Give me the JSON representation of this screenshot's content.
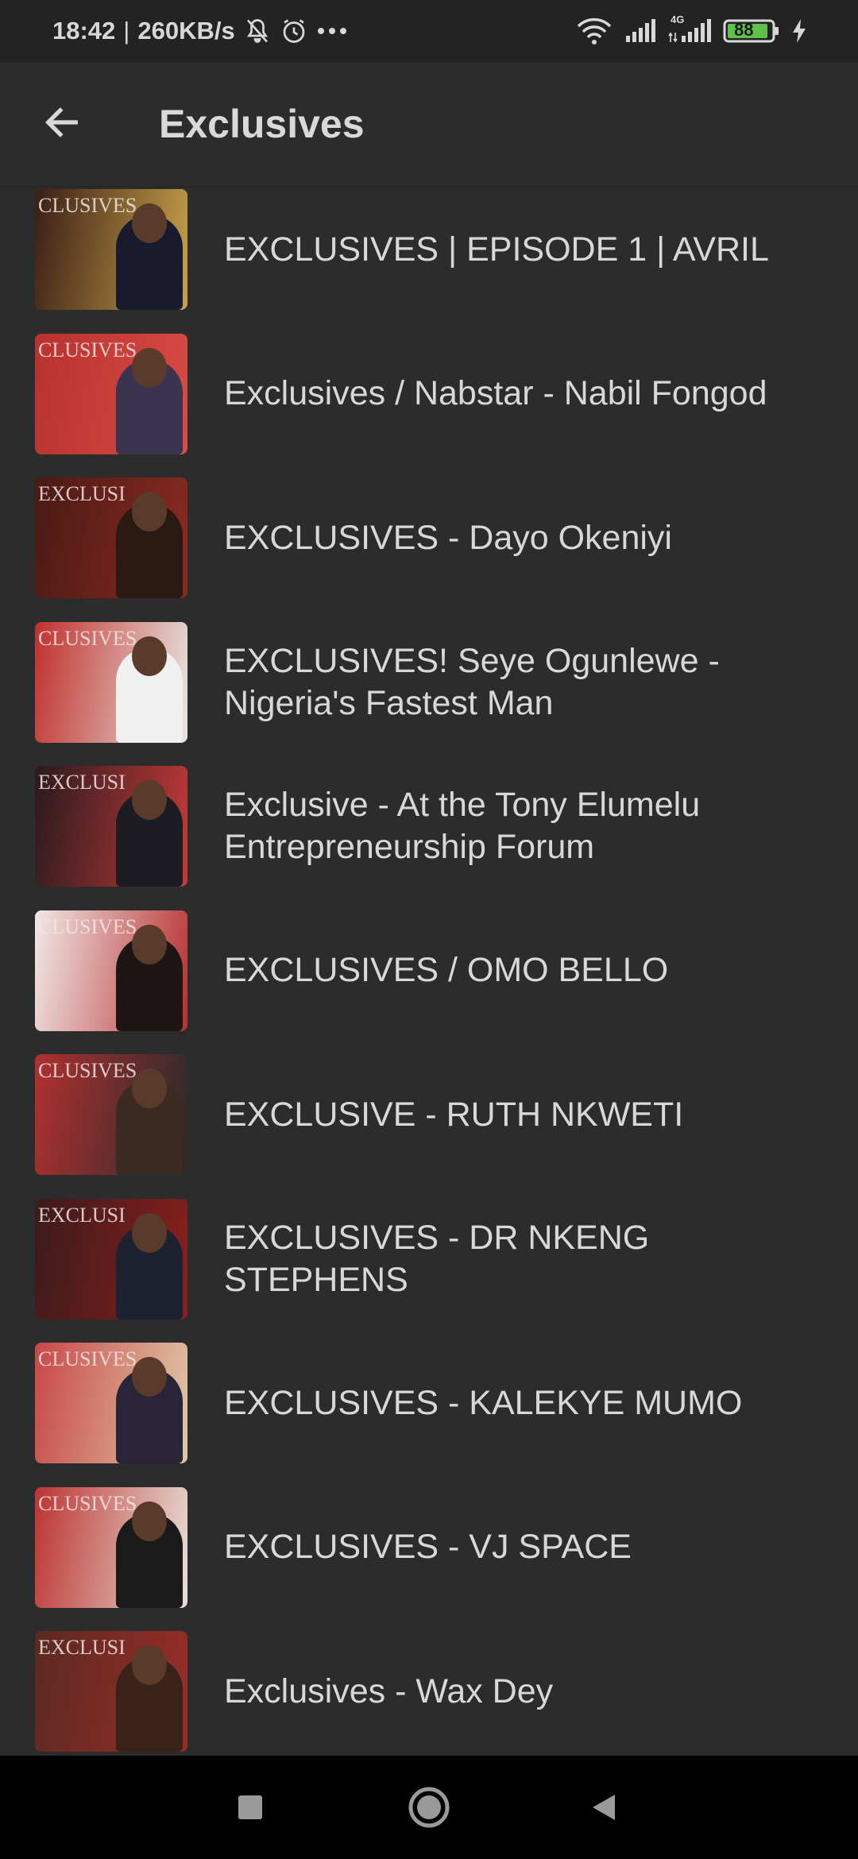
{
  "status_bar": {
    "time": "18:42",
    "speed": "260KB/s",
    "battery": "88",
    "network": "4G"
  },
  "app_bar": {
    "title": "Exclusives",
    "back_icon": "arrow-left-icon"
  },
  "colors": {
    "background": "#2c2c2c",
    "status_bar": "#232323",
    "nav_bar": "#000000",
    "text": "#d8d8d8",
    "battery": "#5ec24a"
  },
  "videos": [
    {
      "title": "EXCLUSIVES | EPISODE 1 | AVRIL",
      "thumb_text": "CLUSIVES",
      "bg": "#3a1e16",
      "accent": "#c9a24a",
      "figure": "#1a1a2e"
    },
    {
      "title": "Exclusives / Nabstar - Nabil Fongod",
      "thumb_text": "CLUSIVES",
      "bg": "#b8322f",
      "accent": "#d94a44",
      "figure": "#3a3450"
    },
    {
      "title": "EXCLUSIVES - Dayo Okeniyi",
      "thumb_text": "EXCLUSI",
      "bg": "#4a1a14",
      "accent": "#8a2a22",
      "figure": "#2a1a12"
    },
    {
      "title": "EXCLUSIVES! Seye Ogunlewe - Nigeria's Fastest Man",
      "thumb_text": "CLUSIVES",
      "bg": "#c0302c",
      "accent": "#e8e6e2",
      "figure": "#f0f0f0"
    },
    {
      "title": "Exclusive - At the Tony Elumelu Entrepreneurship Forum",
      "thumb_text": "EXCLUSI",
      "bg": "#2a1a1e",
      "accent": "#c43a38",
      "figure": "#1c1c22"
    },
    {
      "title": "EXCLUSIVES / OMO BELLO",
      "thumb_text": "CLUSIVES",
      "bg": "#f0e8e6",
      "accent": "#b83030",
      "figure": "#1e1616"
    },
    {
      "title": "EXCLUSIVE - RUTH NKWETI",
      "thumb_text": "CLUSIVES",
      "bg": "#b03030",
      "accent": "#2a2a2a",
      "figure": "#3a2a22"
    },
    {
      "title": "EXCLUSIVES - DR NKENG STEPHENS",
      "thumb_text": "EXCLUSI",
      "bg": "#3a1c1a",
      "accent": "#8a1e1e",
      "figure": "#1e2230"
    },
    {
      "title": "EXCLUSIVES - KALEKYE MUMO",
      "thumb_text": "CLUSIVES",
      "bg": "#c84848",
      "accent": "#e0c8a8",
      "figure": "#2a2438"
    },
    {
      "title": "EXCLUSIVES - VJ SPACE",
      "thumb_text": "CLUSIVES",
      "bg": "#bc3432",
      "accent": "#e8e0d8",
      "figure": "#1a1a1a"
    },
    {
      "title": "Exclusives - Wax Dey",
      "thumb_text": "EXCLUSI",
      "bg": "#5a2a22",
      "accent": "#9a2c28",
      "figure": "#3a2218"
    }
  ],
  "nav_bar": {
    "recents_icon": "square-icon",
    "home_icon": "circle-icon",
    "back_icon": "triangle-back-icon"
  }
}
